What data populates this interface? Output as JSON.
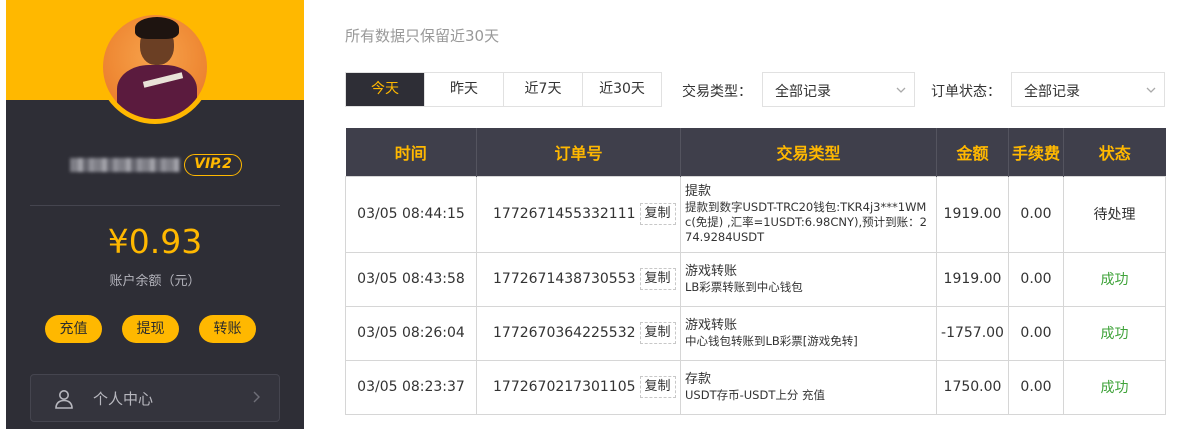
{
  "sidebar": {
    "vip_badge": "VIP.2",
    "balance": "¥0.93",
    "balance_label": "账户余额（元）",
    "actions": {
      "recharge": "充值",
      "withdraw": "提现",
      "transfer": "转账"
    },
    "menu": {
      "personal_center": "个人中心"
    }
  },
  "main": {
    "subtitle": "所有数据只保留近30天",
    "date_tabs": [
      "今天",
      "昨天",
      "近7天",
      "近30天"
    ],
    "active_tab": "今天",
    "filters": {
      "type_label": "交易类型：",
      "type_value": "全部记录",
      "status_label": "订单状态：",
      "status_value": "全部记录"
    }
  },
  "table": {
    "headers": [
      "时间",
      "订单号",
      "交易类型",
      "金额",
      "手续费",
      "状态"
    ],
    "copy_label": "复制",
    "rows": [
      {
        "time": "03/05 08:44:15",
        "order": "1772671455332111",
        "type": "提款",
        "detail": "提款到数字USDT-TRC20钱包:TKR4j3***1WMc(免提) ,汇率=1USDT:6.98CNY),预计到账：274.9284USDT",
        "amount": "1919.00",
        "fee": "0.00",
        "status": "待处理"
      },
      {
        "time": "03/05 08:43:58",
        "order": "1772671438730553",
        "type": "游戏转账",
        "detail": "LB彩票转账到中心钱包",
        "amount": "1919.00",
        "fee": "0.00",
        "status": "成功"
      },
      {
        "time": "03/05 08:26:04",
        "order": "1772670364225532",
        "type": "游戏转账",
        "detail": "中心钱包转账到LB彩票[游戏免转]",
        "amount": "-1757.00",
        "fee": "0.00",
        "status": "成功"
      },
      {
        "time": "03/05 08:23:37",
        "order": "1772670217301105",
        "type": "存款",
        "detail": "USDT存币-USDT上分 充值",
        "amount": "1750.00",
        "fee": "0.00",
        "status": "成功"
      }
    ]
  },
  "colors": {
    "accent": "#ffb800",
    "sidebar_bg": "#2e2e36",
    "success": "#3fa33a"
  },
  "icons": {
    "user": "user-icon",
    "chevron": "chevron-right-icon",
    "dropdown": "chevron-down-icon"
  }
}
